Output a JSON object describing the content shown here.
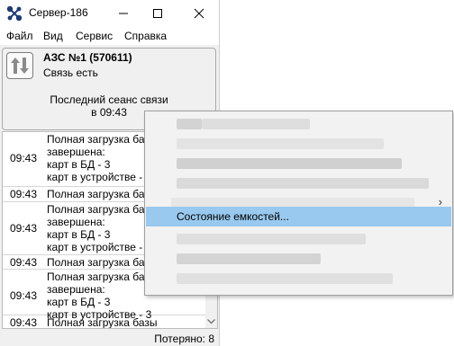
{
  "window": {
    "title": "Сервер-186",
    "minimize_symbol": "—",
    "close_symbol": "✕"
  },
  "menu": [
    "Файл",
    "Вид",
    "Сервис",
    "Справка"
  ],
  "station": {
    "icon": "up-down-arrows-icon",
    "name": "АЗС №1 (570611)",
    "status": "Связь есть",
    "session_label": "Последний сеанс связи",
    "session_time": "в 09:43"
  },
  "log": [
    {
      "time": "09:43",
      "lines": [
        "Полная загрузка базы",
        "завершена:",
        "карт в БД - 3",
        "карт в устройстве - 3"
      ]
    },
    {
      "time": "09:43",
      "lines": [
        "Полная загрузка базы"
      ]
    },
    {
      "time": "09:43",
      "lines": [
        "Полная загрузка базы",
        "завершена:",
        "карт в БД - 3",
        "карт в устройстве - 3"
      ]
    },
    {
      "time": "09:43",
      "lines": [
        "Полная загрузка базы"
      ]
    },
    {
      "time": "09:43",
      "lines": [
        "Полная загрузка базы",
        "завершена:",
        "карт в БД - 3",
        "карт в устройстве - 3"
      ]
    },
    {
      "time": "09:43",
      "lines": [
        "Полная загрузка базы"
      ]
    }
  ],
  "status_bar": {
    "lost": "Потеряно: 8"
  },
  "context_menu": {
    "highlighted_label": "Состояние емкостей...",
    "submenu_arrow": "›",
    "highlight_color": "#99c9ef"
  }
}
